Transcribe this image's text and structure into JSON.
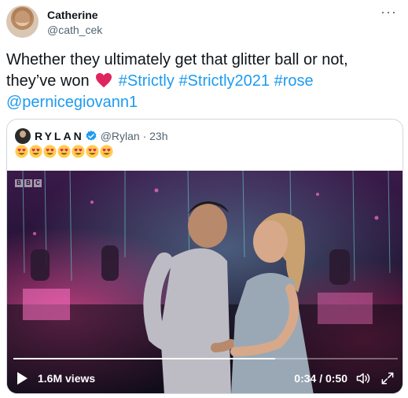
{
  "tweet": {
    "author_name": "Catherine",
    "author_handle": "@cath_cek",
    "more_icon": "more-dots-icon",
    "text_line1": "Whether they ultimately get that glitter ball or not,",
    "text_line2_pre": "they’ve won",
    "hashtags": [
      "#Strictly",
      "#Strictly2021",
      "#rose"
    ],
    "mention": "@pernicegiovann1"
  },
  "quoted": {
    "author_name": "RYLAN",
    "handle_time": "@Rylan · 23h",
    "emoji_count": 7,
    "emoji_name": "heart-eyes-emoji"
  },
  "video": {
    "channel_logo": "BBC",
    "views": "1.6M views",
    "time": "0:34 / 0:50",
    "progress": 0.68
  },
  "colors": {
    "link": "#1d9bf0",
    "secondary": "#536471",
    "verified": "#1d9bf0",
    "heart": "#e0245e"
  }
}
